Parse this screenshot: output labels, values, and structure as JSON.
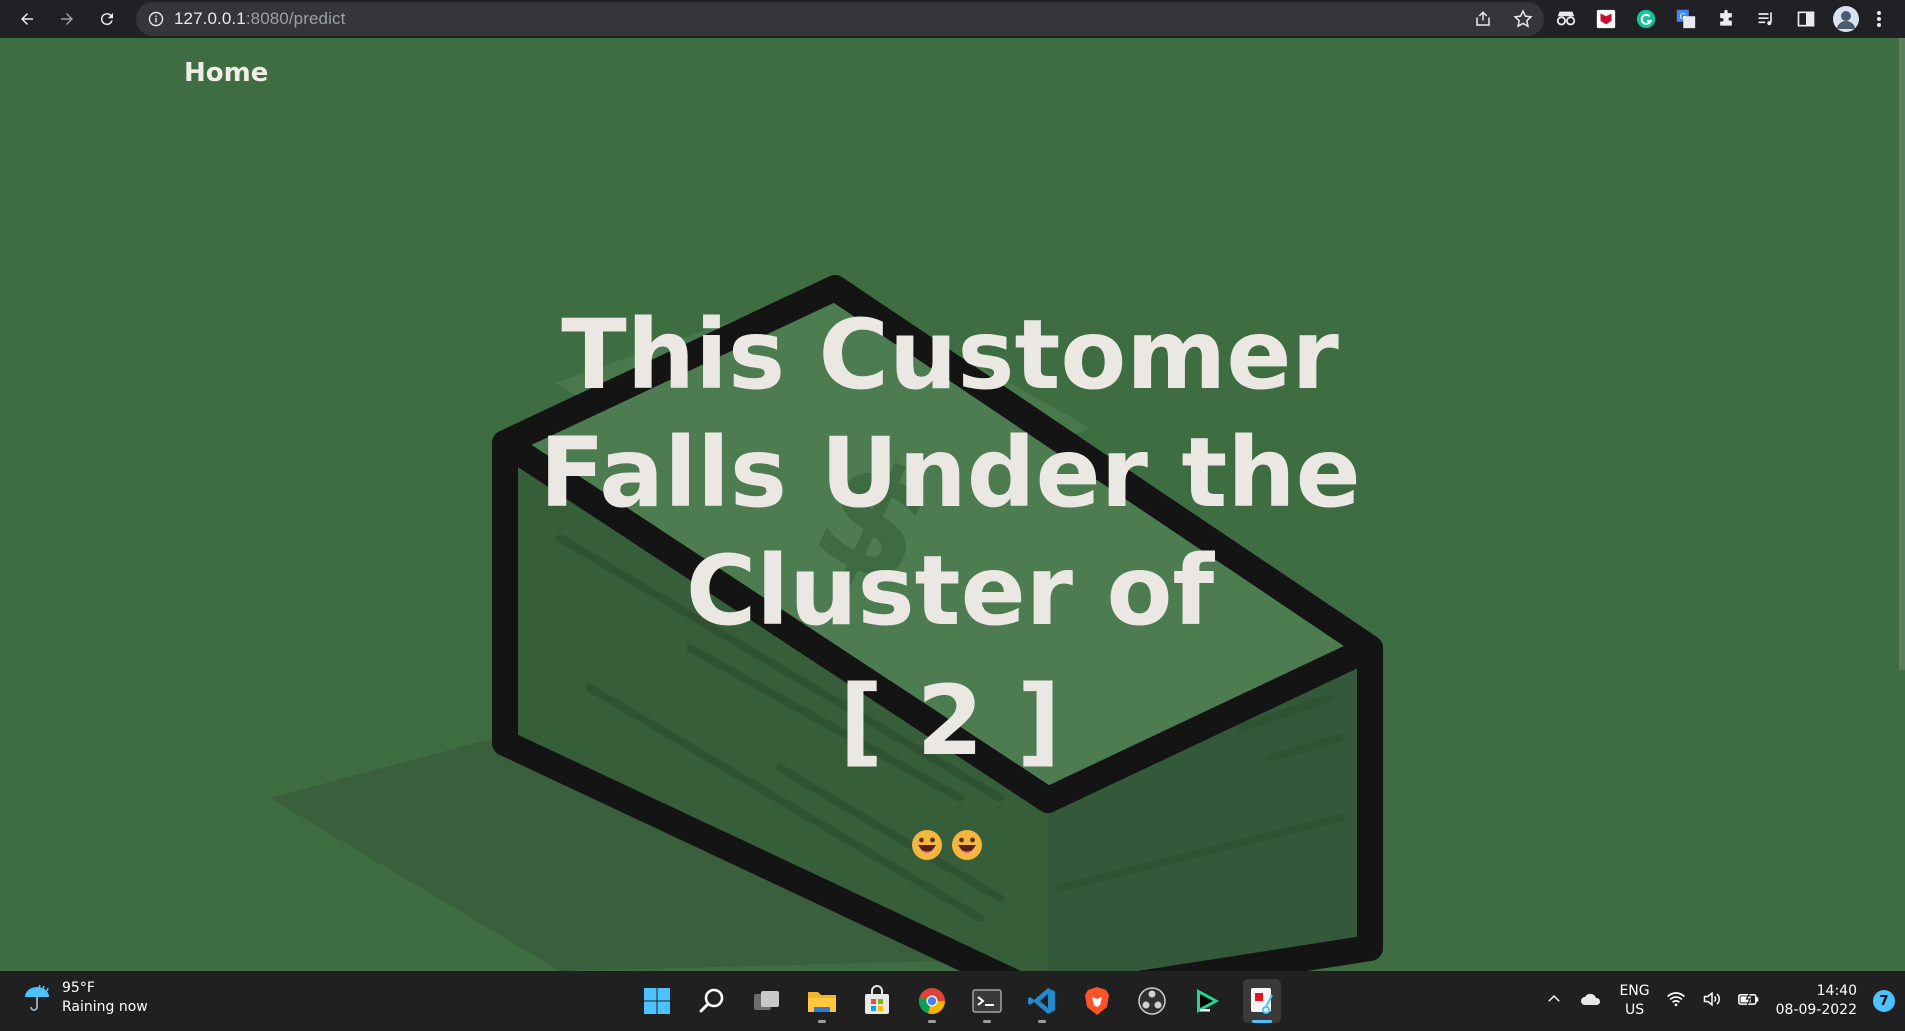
{
  "browser": {
    "url_host": "127.0.0.1",
    "url_rest": ":8080/predict"
  },
  "page": {
    "nav_home": "Home",
    "headline_line1": "This Customer",
    "headline_line2": "Falls Under the",
    "headline_line3": "Cluster of",
    "cluster_value": "[ 2 ]",
    "background_color": "#3e6d41",
    "text_color": "#ebe8e4"
  },
  "taskbar": {
    "weather_temp": "95°F",
    "weather_status": "Raining now",
    "lang_line1": "ENG",
    "lang_line2": "US",
    "time": "14:40",
    "date": "08-09-2022",
    "notification_count": "7"
  }
}
